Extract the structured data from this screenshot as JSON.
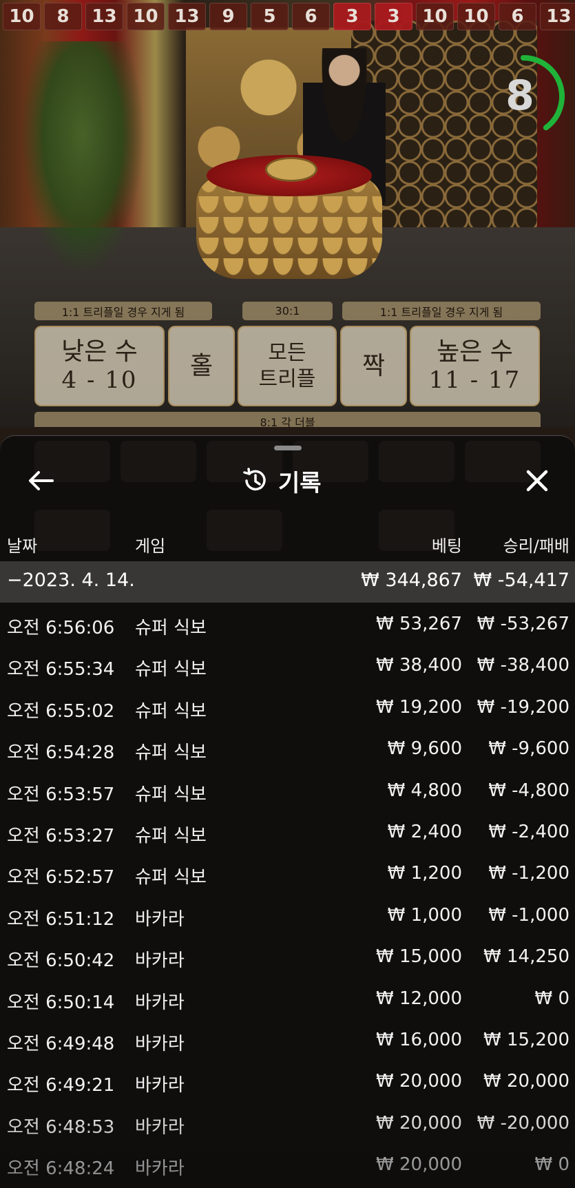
{
  "history_numbers": [
    {
      "value": "10",
      "red": false
    },
    {
      "value": "8",
      "red": false
    },
    {
      "value": "13",
      "red": false
    },
    {
      "value": "10",
      "red": false
    },
    {
      "value": "13",
      "red": false
    },
    {
      "value": "9",
      "red": false
    },
    {
      "value": "5",
      "red": false
    },
    {
      "value": "6",
      "red": false
    },
    {
      "value": "3",
      "red": true
    },
    {
      "value": "3",
      "red": true
    },
    {
      "value": "10",
      "red": false
    },
    {
      "value": "10",
      "red": false
    },
    {
      "value": "6",
      "red": false
    },
    {
      "value": "13",
      "red": false
    }
  ],
  "timer": {
    "value": "8",
    "color": "#1fb33a",
    "fraction": 0.4
  },
  "odds": {
    "left": "1:1 트리플일 경우 지게 됨",
    "center": "30:1",
    "right": "1:1 트리플일 경우 지게 됨",
    "doubles": "8:1 각 더블"
  },
  "bets": {
    "low": {
      "label": "낮은 수",
      "range": "4 - 10"
    },
    "odd": {
      "label": "홀"
    },
    "triple": {
      "line1": "모든",
      "line2": "트리플"
    },
    "even": {
      "label": "짝"
    },
    "high": {
      "label": "높은 수",
      "range": "11 - 17"
    }
  },
  "sheet": {
    "title": "기록",
    "icons": {
      "back": "back-arrow-icon",
      "history": "history-icon",
      "close": "close-icon"
    },
    "columns": {
      "date": "날짜",
      "game": "게임",
      "bet": "베팅",
      "winloss": "승리/패배"
    },
    "date_group": {
      "date": "−2023. 4. 14.",
      "bet": "₩ 344,867",
      "winloss": "₩ -54,417"
    },
    "rows": [
      {
        "time": "오전 6:56:06",
        "game": "슈퍼 식보",
        "bet": "₩ 53,267",
        "winloss": "₩ -53,267"
      },
      {
        "time": "오전 6:55:34",
        "game": "슈퍼 식보",
        "bet": "₩ 38,400",
        "winloss": "₩ -38,400"
      },
      {
        "time": "오전 6:55:02",
        "game": "슈퍼 식보",
        "bet": "₩ 19,200",
        "winloss": "₩ -19,200"
      },
      {
        "time": "오전 6:54:28",
        "game": "슈퍼 식보",
        "bet": "₩ 9,600",
        "winloss": "₩ -9,600"
      },
      {
        "time": "오전 6:53:57",
        "game": "슈퍼 식보",
        "bet": "₩ 4,800",
        "winloss": "₩ -4,800"
      },
      {
        "time": "오전 6:53:27",
        "game": "슈퍼 식보",
        "bet": "₩ 2,400",
        "winloss": "₩ -2,400"
      },
      {
        "time": "오전 6:52:57",
        "game": "슈퍼 식보",
        "bet": "₩ 1,200",
        "winloss": "₩ -1,200"
      },
      {
        "time": "오전 6:51:12",
        "game": "바카라",
        "bet": "₩ 1,000",
        "winloss": "₩ -1,000"
      },
      {
        "time": "오전 6:50:42",
        "game": "바카라",
        "bet": "₩ 15,000",
        "winloss": "₩ 14,250"
      },
      {
        "time": "오전 6:50:14",
        "game": "바카라",
        "bet": "₩ 12,000",
        "winloss": "₩ 0"
      },
      {
        "time": "오전 6:49:48",
        "game": "바카라",
        "bet": "₩ 16,000",
        "winloss": "₩ 15,200"
      },
      {
        "time": "오전 6:49:21",
        "game": "바카라",
        "bet": "₩ 20,000",
        "winloss": "₩ 20,000"
      },
      {
        "time": "오전 6:48:53",
        "game": "바카라",
        "bet": "₩ 20,000",
        "winloss": "₩ -20,000"
      },
      {
        "time": "오전 6:48:24",
        "game": "바카라",
        "bet": "₩ 20,000",
        "winloss": "₩ 0"
      }
    ]
  }
}
